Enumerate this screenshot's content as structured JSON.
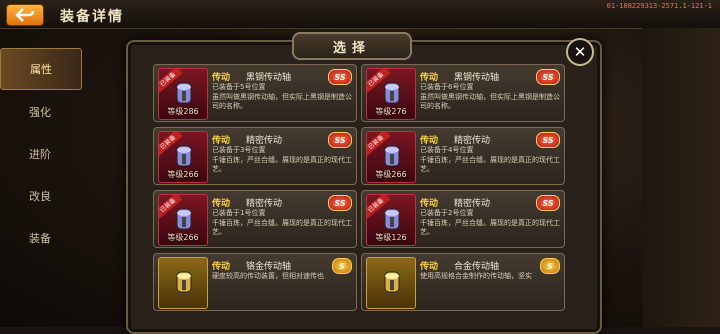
{
  "header": {
    "title": "装备详情",
    "build": "01-108229313-2571.1-121-1"
  },
  "sidebar": {
    "tabs": [
      "属性",
      "强化",
      "进阶",
      "改良",
      "装备"
    ]
  },
  "dialog": {
    "title": "选择",
    "close": "✕"
  },
  "cards": [
    {
      "type": "传动",
      "name": "黑钢传动轴",
      "desc": "已装备于5号位置\n虽然叫做黑钢传动轴，但实际上黑钢是制造公司的名称。",
      "level": "等级286",
      "rarity": "SS",
      "equipped": "已装备",
      "tier": "red"
    },
    {
      "type": "传动",
      "name": "黑钢传动轴",
      "desc": "已装备于6号位置\n虽然叫做黑钢传动轴，但实际上黑钢是制造公司的名称。",
      "level": "等级276",
      "rarity": "SS",
      "equipped": "已装备",
      "tier": "red"
    },
    {
      "type": "传动",
      "name": "精密传动",
      "desc": "已装备于3号位置\n千锤百炼，严丝合缝。展现的是真正的现代工艺。",
      "level": "等级266",
      "rarity": "SS",
      "equipped": "已装备",
      "tier": "red"
    },
    {
      "type": "传动",
      "name": "精密传动",
      "desc": "已装备于4号位置\n千锤百炼，严丝合缝。展现的是真正的现代工艺。",
      "level": "等级266",
      "rarity": "SS",
      "equipped": "已装备",
      "tier": "red"
    },
    {
      "type": "传动",
      "name": "精密传动",
      "desc": "已装备于1号位置\n千锤百炼，严丝合缝。展现的是真正的现代工艺。",
      "level": "等级266",
      "rarity": "SS",
      "equipped": "已装备",
      "tier": "red"
    },
    {
      "type": "传动",
      "name": "精密传动",
      "desc": "已装备于2号位置\n千锤百炼，严丝合缝。展现的是真正的现代工艺。",
      "level": "等级126",
      "rarity": "SS",
      "equipped": "已装备",
      "tier": "red"
    },
    {
      "type": "传动",
      "name": "铬金传动轴",
      "desc": "硬度较高的传动装置，但相对速传也",
      "level": "",
      "rarity": "S",
      "equipped": "",
      "tier": "gold"
    },
    {
      "type": "传动",
      "name": "合金传动轴",
      "desc": "使用高规格合金制作的传动轴，坚实",
      "level": "",
      "rarity": "S",
      "equipped": "",
      "tier": "gold"
    }
  ],
  "colors": {
    "accent": "#ffcf40",
    "rarity_red": "#c02020",
    "rarity_gold": "#ffd040"
  }
}
